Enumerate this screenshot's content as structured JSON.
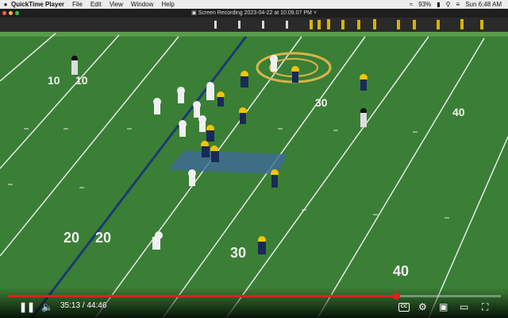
{
  "menubar": {
    "app_name": "QuickTime Player",
    "items": [
      "File",
      "Edit",
      "View",
      "Window",
      "Help"
    ],
    "battery": "93%",
    "clock": "Sun 6:48 AM"
  },
  "window": {
    "title": "Screen Recording 2023-04-22 at 10.09.07 PM"
  },
  "field": {
    "yard_numbers": [
      "10",
      "20",
      "30",
      "40",
      "10",
      "20",
      "30",
      "40"
    ]
  },
  "player": {
    "time": "35:13 / 44:46",
    "progress": 0.787,
    "cc_label": "CC"
  },
  "colors": {
    "turf": "#3a7f35",
    "progress": "#e02020",
    "team_dark": "#1a2a55",
    "team_gold": "#f4c400"
  }
}
